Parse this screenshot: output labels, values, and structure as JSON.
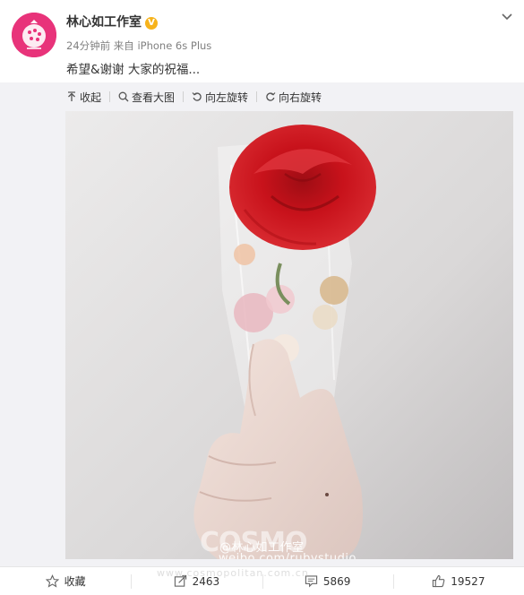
{
  "post": {
    "author": "林心如工作室",
    "verified_badge": "V",
    "time": "24分钟前",
    "source_prefix": "来自",
    "source": "iPhone 6s Plus",
    "text": "希望&谢谢 大家的祝福..."
  },
  "toolbar": {
    "collapse": "收起",
    "view_large": "查看大图",
    "rotate_left": "向左旋转",
    "rotate_right": "向右旋转"
  },
  "watermark": {
    "logo": "COSMO",
    "line1": "@林心如工作室",
    "line2": "weibo.com/rubystudio",
    "site": "www.cosmopolitan.com.cn"
  },
  "actions": {
    "favorite": "收藏",
    "repost_count": "2463",
    "comment_count": "5869",
    "like_count": "19527"
  },
  "icons": {
    "chevron": "chevron-down-icon",
    "collapse": "collapse-arrow-icon",
    "zoom": "magnifier-icon",
    "rotate_left": "rotate-left-icon",
    "rotate_right": "rotate-right-icon",
    "favorite": "star-icon",
    "repost": "repost-icon",
    "comment": "comment-icon",
    "like": "thumbs-up-icon"
  },
  "colors": {
    "avatar_bg": "#e8337a",
    "verified": "#f7b31b",
    "rose": "#c8121b",
    "panel_bg": "#f2f2f5"
  }
}
